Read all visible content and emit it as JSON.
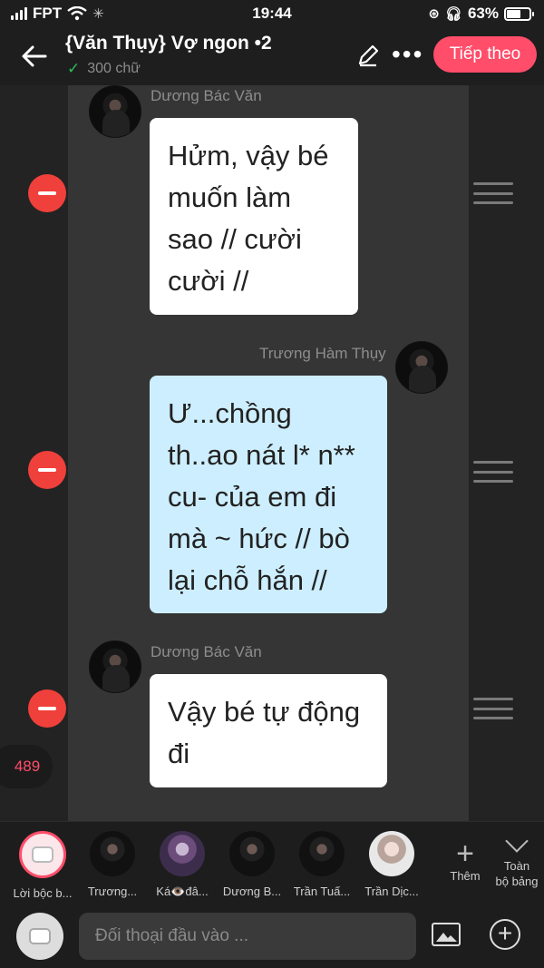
{
  "status_bar": {
    "carrier": "FPT",
    "time": "19:44",
    "battery": "63%",
    "battery_level": 0.63
  },
  "header": {
    "title": "{Văn Thụy} Vợ ngon •2",
    "word_count": "300 chữ",
    "next_label": "Tiếp theo",
    "more_glyph": "•••"
  },
  "messages": [
    {
      "sender": "Dương Bác Văn",
      "side": "left",
      "text": "Hửm, vậy bé muốn làm sao // cười cười //",
      "bubble_color": "#ffffff"
    },
    {
      "sender": "Trương Hàm Thụy",
      "side": "right",
      "text": "Ư...chồng th..ao nát l* n** cu- của em đi mà ~ hức // bò lại chỗ hắn //",
      "bubble_color": "#cdeefe"
    },
    {
      "sender": "Dương Bác Văn",
      "side": "left",
      "text": "Vậy bé tự động đi",
      "bubble_color": "#ffffff"
    }
  ],
  "count_badge": "489",
  "characters": [
    {
      "label": "Lời bộc b...",
      "icon": "narration-icon",
      "selected": true
    },
    {
      "label": "Trương...",
      "icon": "avatar"
    },
    {
      "label": "Ká👁️đâ...",
      "icon": "avatar"
    },
    {
      "label": "Dương B...",
      "icon": "avatar"
    },
    {
      "label": "Trần Tuấ...",
      "icon": "avatar"
    },
    {
      "label": "Trần Dịc...",
      "icon": "avatar"
    }
  ],
  "add_label": "Thêm",
  "all_label_1": "Toàn",
  "all_label_2": "bộ bảng",
  "input": {
    "placeholder": "Đối thoại đầu vào ..."
  },
  "colors": {
    "accent": "#ff4d6a",
    "remove": "#f0403b",
    "bubble_blue": "#cdeefe",
    "check": "#2bbf5a"
  }
}
